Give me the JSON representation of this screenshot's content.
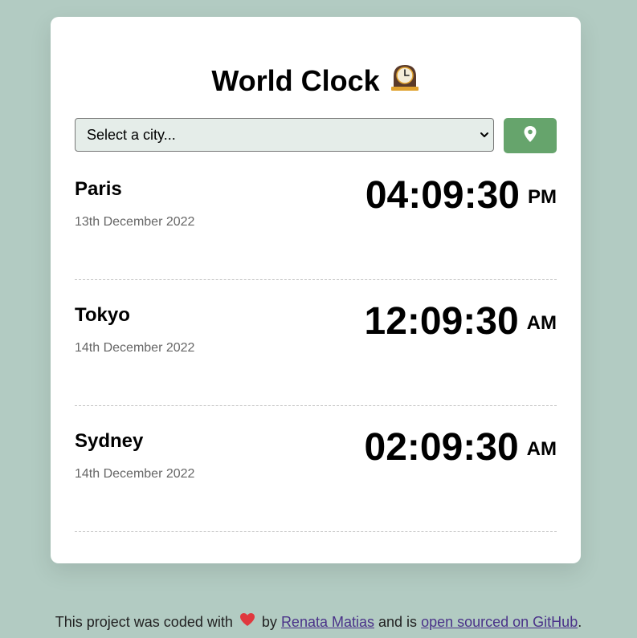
{
  "app": {
    "title": "World Clock"
  },
  "search": {
    "selected": "Select a city..."
  },
  "location_button": {
    "icon": "map-pin-icon"
  },
  "cities": [
    {
      "name": "Paris",
      "date": "13th December 2022",
      "time": "04:09:30",
      "ampm": "PM"
    },
    {
      "name": "Tokyo",
      "date": "14th December 2022",
      "time": "12:09:30",
      "ampm": "AM"
    },
    {
      "name": "Sydney",
      "date": "14th December 2022",
      "time": "02:09:30",
      "ampm": "AM"
    }
  ],
  "footer": {
    "text_before": "This project was coded with",
    "text_by": "by",
    "author_link": "Renata Matias",
    "text_middle": "and is",
    "source_link": "open sourced on GitHub",
    "text_end": "."
  },
  "colors": {
    "background": "#b2cbc2",
    "card": "#ffffff",
    "accent": "#66a46c",
    "select_bg": "#e5ede9",
    "heart": "#e0383e",
    "link": "#4a3289"
  }
}
